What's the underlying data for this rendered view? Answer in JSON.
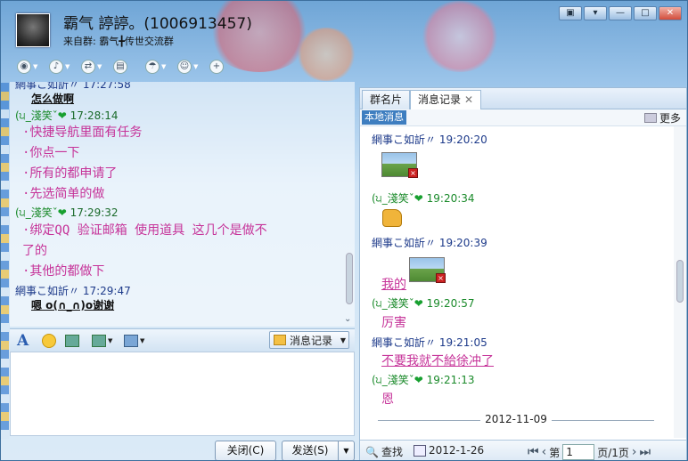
{
  "window": {
    "title": "霸气 諪諪。(1006913457)",
    "subtitle_prefix": "来自群:",
    "subtitle_group": "霸气╋传世交流群",
    "controls": [
      "▣",
      "▾",
      "—",
      "□",
      "✕"
    ]
  },
  "toolbar": {
    "icons": [
      "video-icon",
      "mic-icon",
      "file-transfer-icon",
      "screenshot-icon",
      "app-icon",
      "remote-icon",
      "add-icon"
    ]
  },
  "chat": {
    "messages": [
      {
        "sender": "網事こ如訢〃",
        "time": "17:27:58",
        "lines": [
          "怎么做啊"
        ],
        "style": "bold"
      },
      {
        "sender": "(੫_淺笑ˇ",
        "time": "17:28:14",
        "lines": [
          "·快捷导航里面有任务",
          "·你点一下",
          "·所有的都申请了",
          "·先选简单的做"
        ],
        "style": "pink"
      },
      {
        "sender": "(੫_淺笑ˇ",
        "time": "17:29:32",
        "lines": [
          "·绑定QQ 验证邮箱 使用道具  这几个是做不",
          "  了的",
          "·其他的都做下"
        ],
        "style": "pink"
      },
      {
        "sender": "網事こ如訢〃",
        "time": "17:29:47",
        "lines": [
          "嗯 o(∩_∩)o谢谢"
        ],
        "style": "bold"
      }
    ]
  },
  "input_toolbar": {
    "font_label": "A",
    "history_label": "消息记录"
  },
  "buttons": {
    "close": "关闭(C)",
    "send": "发送(S)"
  },
  "right": {
    "tabs": [
      "群名片",
      "消息记录"
    ],
    "local_label": "本地消息",
    "more_label": "更多",
    "messages": [
      {
        "sender": "網事こ如訢〃",
        "time": "19:20:20",
        "kind": "image"
      },
      {
        "sender": "(੫_淺笑ˇ",
        "time": "19:20:34",
        "kind": "thumb"
      },
      {
        "sender": "網事こ如訢〃",
        "time": "19:20:39",
        "kind": "image",
        "text": "我的"
      },
      {
        "sender": "(੫_淺笑ˇ",
        "time": "19:20:57",
        "text": "厉害"
      },
      {
        "sender": "網事こ如訢〃",
        "time": "19:21:05",
        "text": "不要我就不給徐冲了"
      },
      {
        "sender": "(੫_淺笑ˇ",
        "time": "19:21:13",
        "text": "恩"
      }
    ],
    "date_divider": "2012-11-09",
    "bottom": {
      "find": "查找",
      "date": "2012-1-26",
      "page_prefix": "第",
      "page_value": "1",
      "page_suffix": "页/1页"
    }
  }
}
